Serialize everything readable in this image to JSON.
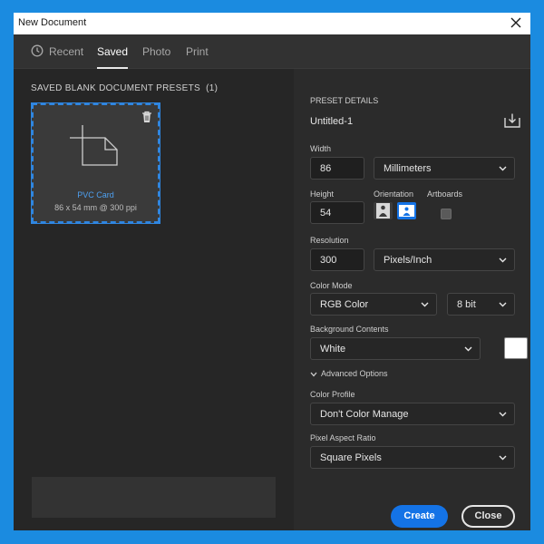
{
  "window": {
    "title": "New Document"
  },
  "tabs": [
    {
      "label": "Recent",
      "active": false,
      "icon": "clock-icon"
    },
    {
      "label": "Saved",
      "active": true
    },
    {
      "label": "Photo",
      "active": false
    },
    {
      "label": "Print",
      "active": false
    }
  ],
  "presets": {
    "section_title": "SAVED BLANK DOCUMENT PRESETS",
    "count_label": "(1)",
    "items": [
      {
        "name": "PVC Card",
        "dimensions": "86 x 54 mm @ 300 ppi",
        "selected": true
      }
    ]
  },
  "details": {
    "heading": "PRESET DETAILS",
    "doc_name": "Untitled-1",
    "width_label": "Width",
    "width_value": "86",
    "width_unit": "Millimeters",
    "height_label": "Height",
    "height_value": "54",
    "orientation_label": "Orientation",
    "artboards_label": "Artboards",
    "resolution_label": "Resolution",
    "resolution_value": "300",
    "resolution_unit": "Pixels/Inch",
    "color_mode_label": "Color Mode",
    "color_mode": "RGB Color",
    "bit_depth": "8 bit",
    "background_label": "Background Contents",
    "background": "White",
    "background_color": "#ffffff",
    "advanced_label": "Advanced Options",
    "color_profile_label": "Color Profile",
    "color_profile": "Don't Color Manage",
    "pixel_aspect_label": "Pixel Aspect Ratio",
    "pixel_aspect": "Square Pixels"
  },
  "buttons": {
    "create": "Create",
    "close": "Close"
  },
  "colors": {
    "accent": "#1473e6",
    "selection": "#2f86e0",
    "frame": "#1b8be0"
  }
}
